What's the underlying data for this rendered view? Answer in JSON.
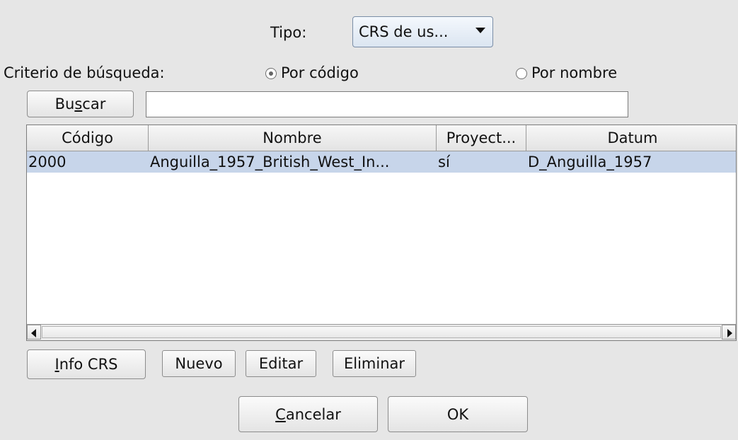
{
  "tipo": {
    "label": "Tipo:",
    "value": "CRS de us..."
  },
  "criterio": {
    "label": "Criterio de búsqueda:",
    "options": [
      {
        "label": "Por código",
        "selected": true
      },
      {
        "label": "Por nombre",
        "selected": false
      }
    ]
  },
  "search": {
    "button_pre": "Bu",
    "button_mn": "s",
    "button_post": "car",
    "value": ""
  },
  "table": {
    "columns": [
      "Código",
      "Nombre",
      "Proyect...",
      "Datum"
    ],
    "rows": [
      [
        "2000",
        "Anguilla_1957_British_West_In...",
        "sí",
        "D_Anguilla_1957"
      ]
    ],
    "selected_row_color": "#c7d5ea"
  },
  "actions": {
    "info_mn": "I",
    "info_rest": "nfo CRS",
    "nuevo": "Nuevo",
    "editar": "Editar",
    "eliminar": "Eliminar"
  },
  "footer": {
    "cancel_mn": "C",
    "cancel_rest": "ancelar",
    "ok": "OK"
  },
  "icons": {
    "combo_arrow": "triangle-down",
    "scroll_left": "triangle-left",
    "scroll_right": "triangle-right"
  }
}
